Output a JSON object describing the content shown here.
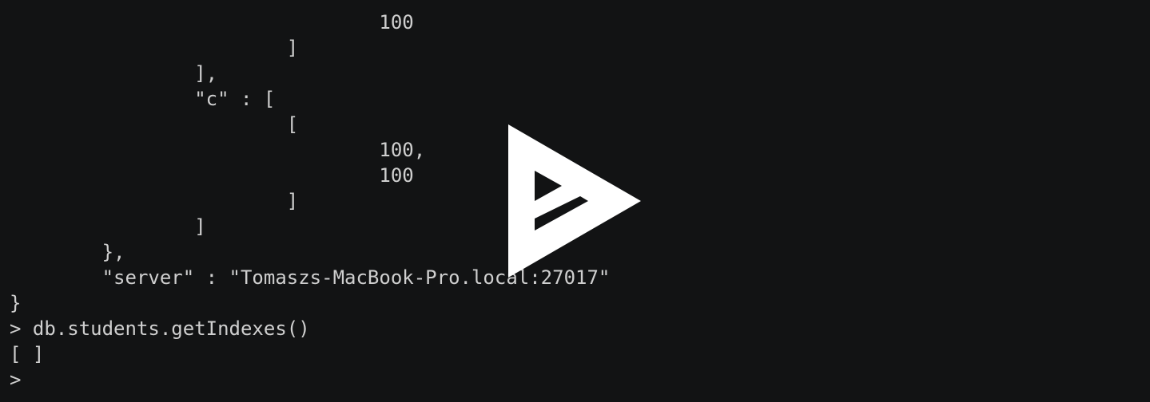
{
  "terminal": {
    "lines": [
      "                                100",
      "                        ]",
      "                ],",
      "                \"c\" : [",
      "                        [",
      "                                100,",
      "                                100",
      "                        ]",
      "                ]",
      "        },",
      "        \"server\" : \"Tomaszs-MacBook-Pro.local:27017\"",
      "}",
      "> db.students.getIndexes()",
      "[ ]",
      ">"
    ]
  },
  "overlay": {
    "icon": "asciinema-play-icon",
    "color": "#ffffff"
  },
  "colors": {
    "background": "#121314",
    "text": "#cfcfcf"
  }
}
